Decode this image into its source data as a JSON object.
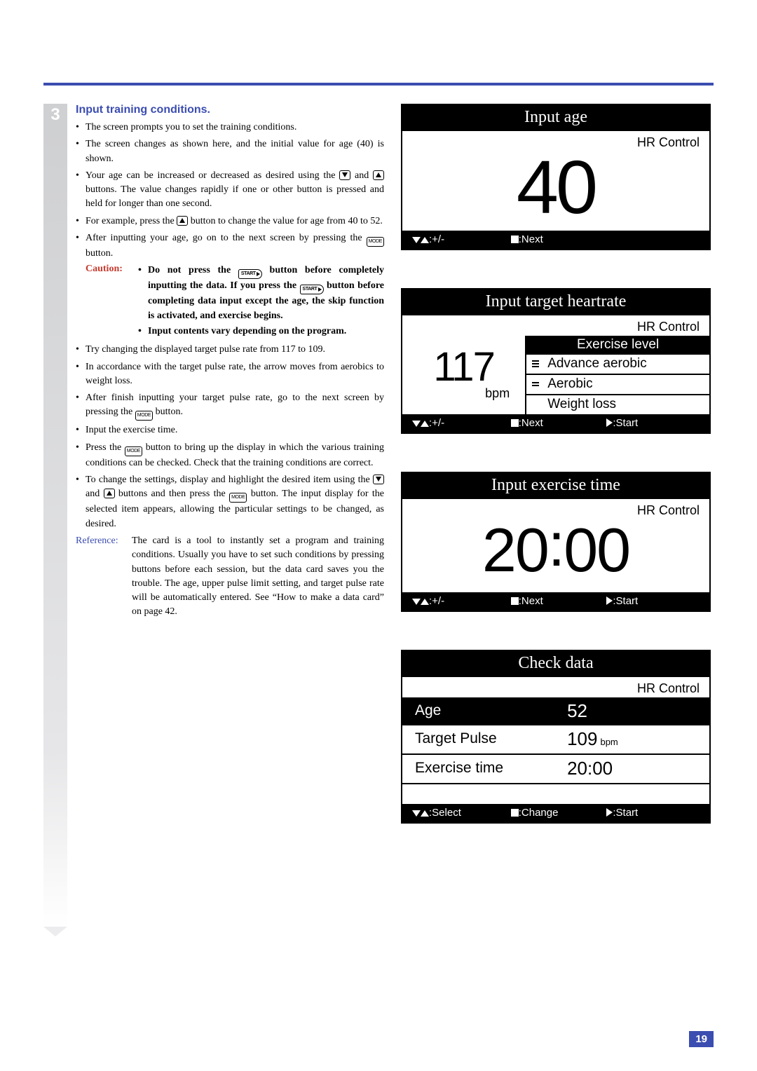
{
  "page_number": "19",
  "step_number": "3",
  "heading": "Input training conditions.",
  "bullets_upper": [
    "The screen prompts you to set the training conditions.",
    "The screen changes as shown here, and the initial value for age (40) is shown.",
    "Your age can be increased or decreased as desired using the {down} and {up} buttons. The value changes rapidly if one or other button is pressed and held for longer than one second.",
    "For example, press the {up} button to change the value for age from 40 to 52.",
    "After inputting your age, go on to the next screen by pressing the {mode} button."
  ],
  "caution_label": "Caution:",
  "caution_items": [
    "Do not press the {start} button before completely inputting the data. If you press the {start} button before completing data input except the age, the skip function is activated, and exercise begins.",
    "Input contents vary depending on the program."
  ],
  "bullets_lower": [
    "Try changing the displayed target pulse rate from 117 to 109.",
    "In accordance with the target pulse rate, the arrow moves from aerobics to weight loss.",
    "After finish inputting your target pulse rate, go to the next screen by pressing the {mode} button.",
    "Input the exercise time.",
    "Press the {mode} button to bring up the display in which the various training conditions can be checked. Check that the training conditions are correct.",
    "To change the settings, display and highlight the desired item using the {down} and {up} buttons and then press the {mode} button. The input display for the selected item appears, allowing the particular settings to be changed, as desired."
  ],
  "reference_label": "Reference:",
  "reference_text": "The card is a tool to instantly set a program and training conditions. Usually you have to set such conditions by pressing buttons before each session, but the data card saves you the trouble. The age, upper pulse limit setting, and target pulse rate will be automatically entered. See “How to make a data card” on page 42.",
  "hr_control_label": "HR Control",
  "screens": {
    "age": {
      "title": "Input age",
      "value": "40",
      "footer_plus": ":+/-",
      "footer_next": ":Next"
    },
    "hr": {
      "title": "Input target heartrate",
      "value": "117",
      "unit": "bpm",
      "ex_header": "Exercise level",
      "levels": [
        "Advance aerobic",
        "Aerobic",
        "Weight loss"
      ],
      "footer_plus": ":+/-",
      "footer_next": ":Next",
      "footer_start": ":Start"
    },
    "time": {
      "title": "Input exercise time",
      "value_mm": "20",
      "value_ss": "00",
      "footer_plus": ":+/-",
      "footer_next": ":Next",
      "footer_start": ":Start"
    },
    "check": {
      "title": "Check data",
      "rows": [
        {
          "label": "Age",
          "value": "52",
          "unit": ""
        },
        {
          "label": "Target Pulse",
          "value": "109",
          "unit": "bpm"
        },
        {
          "label": "Exercise time",
          "value": "20:00",
          "unit": ""
        }
      ],
      "footer_select": ":Select",
      "footer_change": ":Change",
      "footer_start": ":Start"
    }
  },
  "icon_labels": {
    "mode": "MODE",
    "start": "START"
  }
}
